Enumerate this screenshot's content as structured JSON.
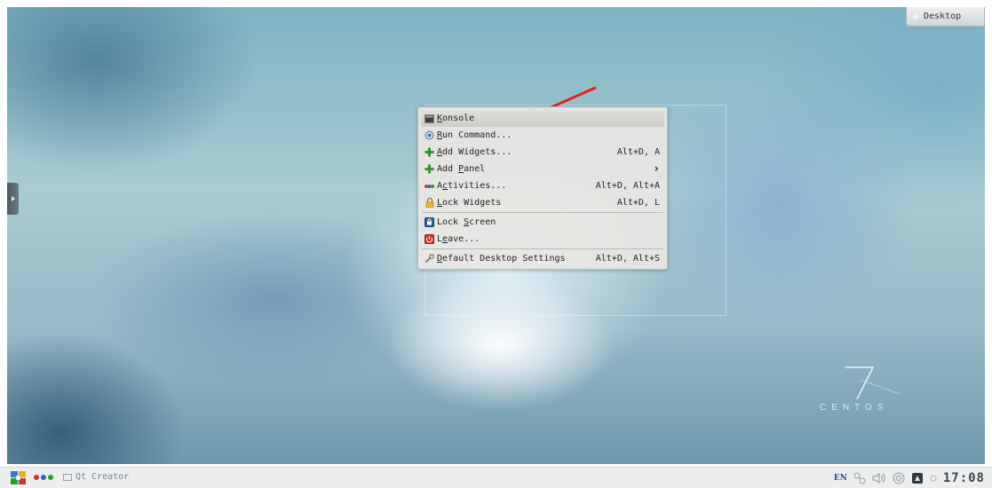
{
  "desktop_button": {
    "label": "Desktop"
  },
  "context_menu": {
    "items": [
      {
        "label_pre": "",
        "label_ul": "K",
        "label_post": "onsole",
        "shortcut": ""
      },
      {
        "label_pre": "",
        "label_ul": "R",
        "label_post": "un Command...",
        "shortcut": ""
      },
      {
        "label_pre": "",
        "label_ul": "A",
        "label_post": "dd Widgets...",
        "shortcut": "Alt+D, A"
      },
      {
        "label_pre": "Add ",
        "label_ul": "P",
        "label_post": "anel",
        "shortcut": ""
      },
      {
        "label_pre": "A",
        "label_ul": "c",
        "label_post": "tivities...",
        "shortcut": "Alt+D, Alt+A"
      },
      {
        "label_pre": "",
        "label_ul": "L",
        "label_post": "ock Widgets",
        "shortcut": "Alt+D, L"
      },
      {
        "label_pre": "Lock ",
        "label_ul": "S",
        "label_post": "creen",
        "shortcut": ""
      },
      {
        "label_pre": "L",
        "label_ul": "e",
        "label_post": "ave...",
        "shortcut": ""
      },
      {
        "label_pre": "",
        "label_ul": "D",
        "label_post": "efault Desktop Settings",
        "shortcut": "Alt+D, Alt+S"
      }
    ],
    "submenu_indicator": "›"
  },
  "branding": {
    "number": "7",
    "name": "CENTOS"
  },
  "taskbar": {
    "task_label": "Qt Creator",
    "language": "EN",
    "clock": "17:08"
  },
  "colors": {
    "menu_bg": "#e8e6e3",
    "arrow": "#e2261b",
    "taskbar_bg": "#eceeef"
  }
}
